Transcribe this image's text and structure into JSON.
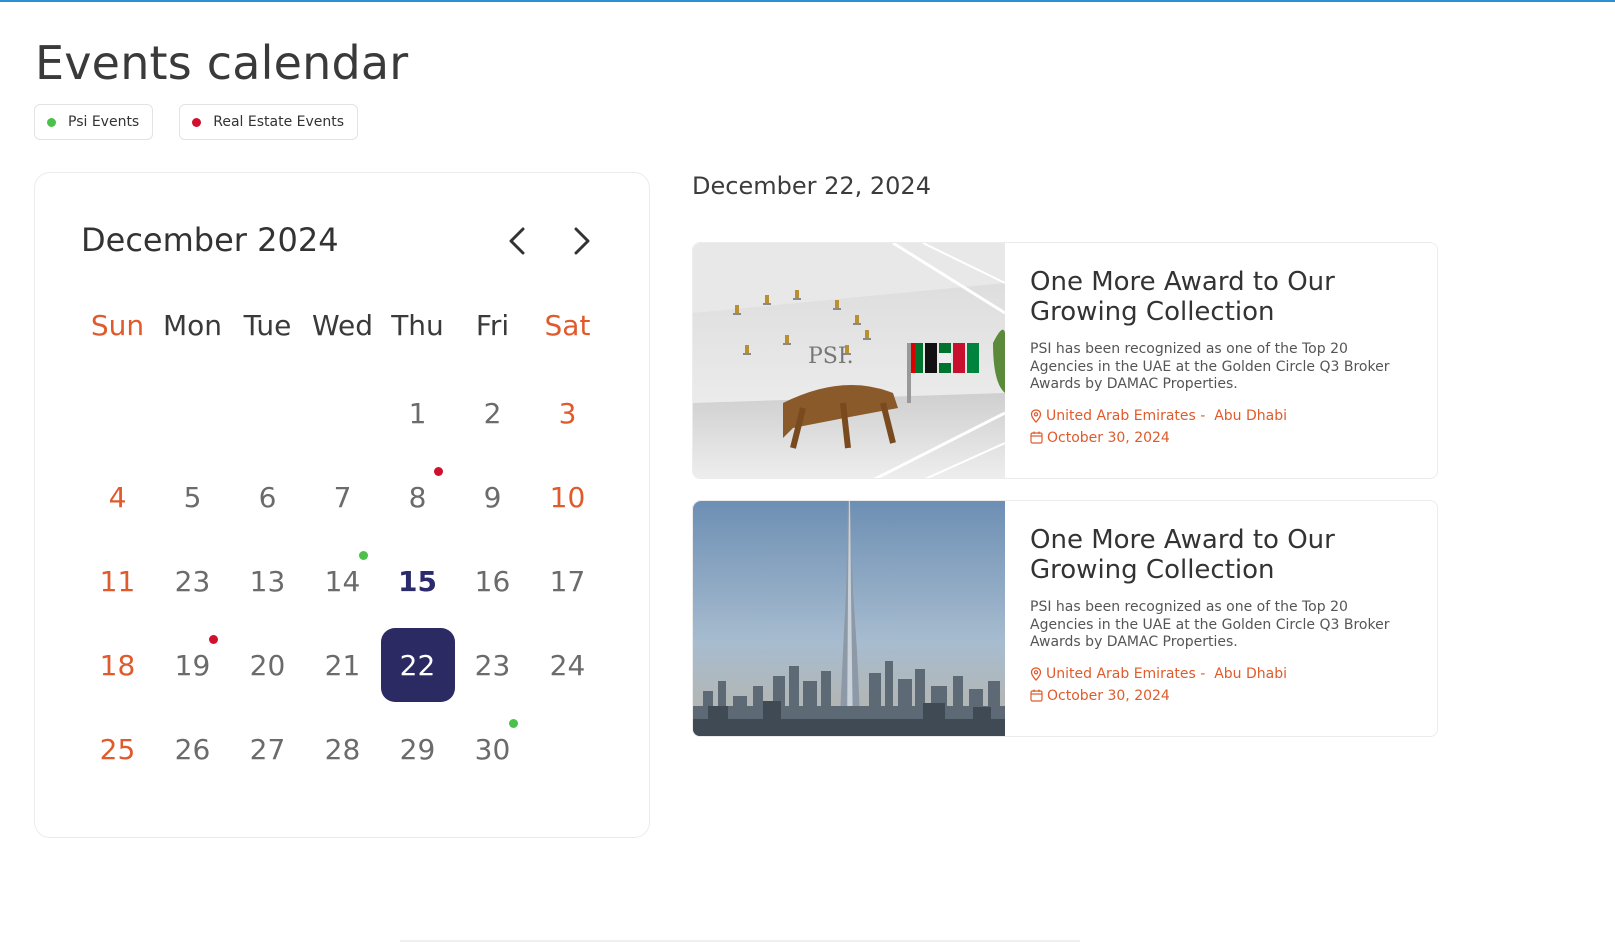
{
  "page": {
    "title": "Events calendar"
  },
  "legend": [
    {
      "label": "Psi Events",
      "color": "#4cc14a"
    },
    {
      "label": "Real Estate Events",
      "color": "#d0102e"
    }
  ],
  "calendar": {
    "month_label": "December 2024",
    "weekdays": [
      "Sun",
      "Mon",
      "Tue",
      "Wed",
      "Thu",
      "Fri",
      "Sat"
    ],
    "weeks": [
      [
        "",
        "",
        "",
        "",
        "1",
        "2",
        "3"
      ],
      [
        "4",
        "5",
        "6",
        "7",
        "8",
        "9",
        "10"
      ],
      [
        "11",
        "23",
        "13",
        "14",
        "15",
        "16",
        "17"
      ],
      [
        "18",
        "19",
        "20",
        "21",
        "22",
        "23",
        "24"
      ],
      [
        "25",
        "26",
        "27",
        "28",
        "29",
        "30",
        ""
      ]
    ],
    "today": "15",
    "selected": "22",
    "events": [
      {
        "week": 1,
        "day": 4,
        "type": "real-estate"
      },
      {
        "week": 2,
        "day": 3,
        "type": "psi"
      },
      {
        "week": 3,
        "day": 1,
        "type": "real-estate"
      },
      {
        "week": 4,
        "day": 5,
        "type": "psi"
      }
    ],
    "colors": {
      "psi": "#4cc14a",
      "real-estate": "#d0102e",
      "weekend": "#e05a2b",
      "selected_bg": "#2b2a63"
    }
  },
  "selected_date_label": "December 22, 2024",
  "events": [
    {
      "title": "One More Award to Our Growing Collection",
      "description": "PSI has been recognized as one of the Top 20 Agencies in the UAE at the Golden Circle Q3 Broker Awards by DAMAC Properties.",
      "location": "United Arab Emirates -  Abu Dhabi",
      "date": "October 30, 2024",
      "image": "office-awards-wall-photo",
      "logo_text": "PSI."
    },
    {
      "title": "One More Award to Our Growing Collection",
      "description": "PSI has been recognized as one of the Top 20 Agencies in the UAE at the Golden Circle Q3 Broker Awards by DAMAC Properties.",
      "location": "United Arab Emirates -  Abu Dhabi",
      "date": "October 30, 2024",
      "image": "dubai-skyline-burj-khalifa-photo"
    }
  ],
  "icons": {
    "prev": "chevron-left-icon",
    "next": "chevron-right-icon",
    "location": "location-pin-icon",
    "date": "calendar-icon"
  }
}
